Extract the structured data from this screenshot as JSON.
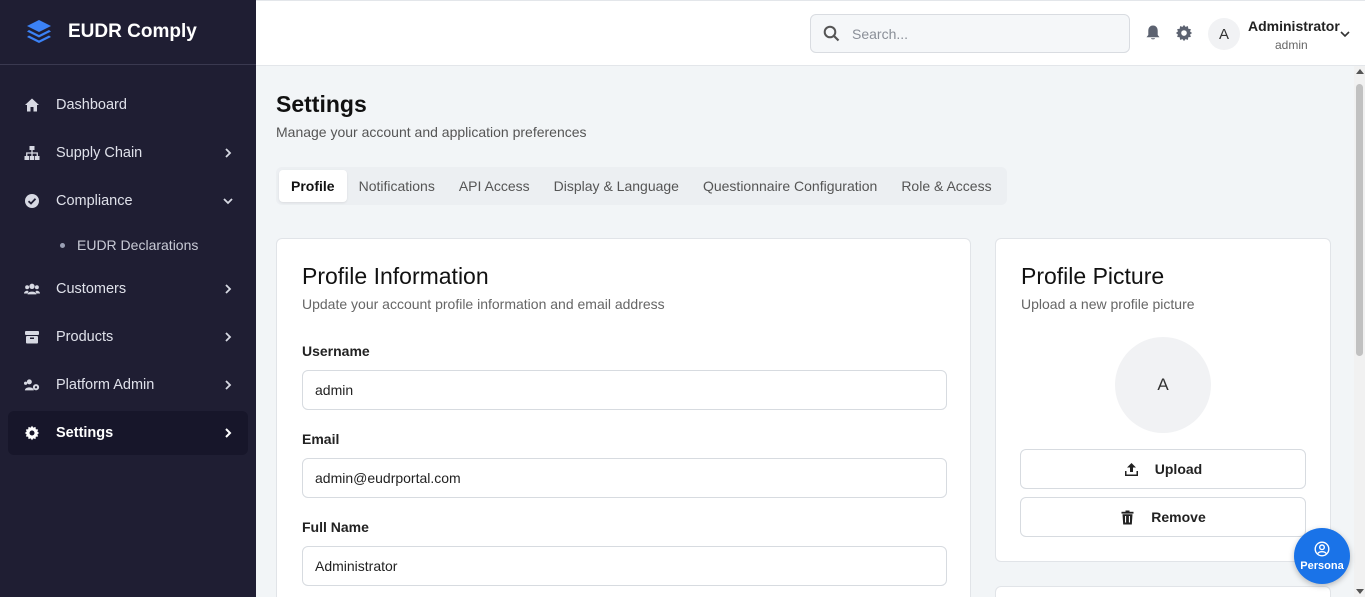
{
  "brand": {
    "name": "EUDR Comply"
  },
  "sidebar": {
    "items": [
      {
        "label": "Dashboard",
        "icon": "home-icon",
        "chevron": "none"
      },
      {
        "label": "Supply Chain",
        "icon": "sitemap-icon",
        "chevron": "right"
      },
      {
        "label": "Compliance",
        "icon": "check-circle-icon",
        "chevron": "down"
      },
      {
        "label": "EUDR Declarations",
        "icon": "dot",
        "sub": true
      },
      {
        "label": "Customers",
        "icon": "users-icon",
        "chevron": "right"
      },
      {
        "label": "Products",
        "icon": "box-icon",
        "chevron": "right"
      },
      {
        "label": "Platform Admin",
        "icon": "users-cog-icon",
        "chevron": "right"
      },
      {
        "label": "Settings",
        "icon": "gear-icon",
        "chevron": "right",
        "active": true
      }
    ]
  },
  "topbar": {
    "search_placeholder": "Search...",
    "avatar_initial": "A",
    "user_name": "Administrator",
    "user_role": "admin"
  },
  "page": {
    "title": "Settings",
    "subtitle": "Manage your account and application preferences"
  },
  "tabs": [
    {
      "label": "Profile",
      "active": true
    },
    {
      "label": "Notifications"
    },
    {
      "label": "API Access"
    },
    {
      "label": "Display & Language"
    },
    {
      "label": "Questionnaire Configuration"
    },
    {
      "label": "Role & Access"
    }
  ],
  "profile_card": {
    "title": "Profile Information",
    "subtitle": "Update your account profile information and email address",
    "fields": [
      {
        "label": "Username",
        "value": "admin"
      },
      {
        "label": "Email",
        "value": "admin@eudrportal.com"
      },
      {
        "label": "Full Name",
        "value": "Administrator"
      }
    ]
  },
  "picture_card": {
    "title": "Profile Picture",
    "subtitle": "Upload a new profile picture",
    "avatar_initial": "A",
    "upload_label": "Upload",
    "remove_label": "Remove"
  },
  "persona": {
    "label": "Persona"
  },
  "colors": {
    "sidebar_bg": "#1f1e33",
    "accent": "#1a73e8",
    "page_bg": "#f2f5f7"
  }
}
